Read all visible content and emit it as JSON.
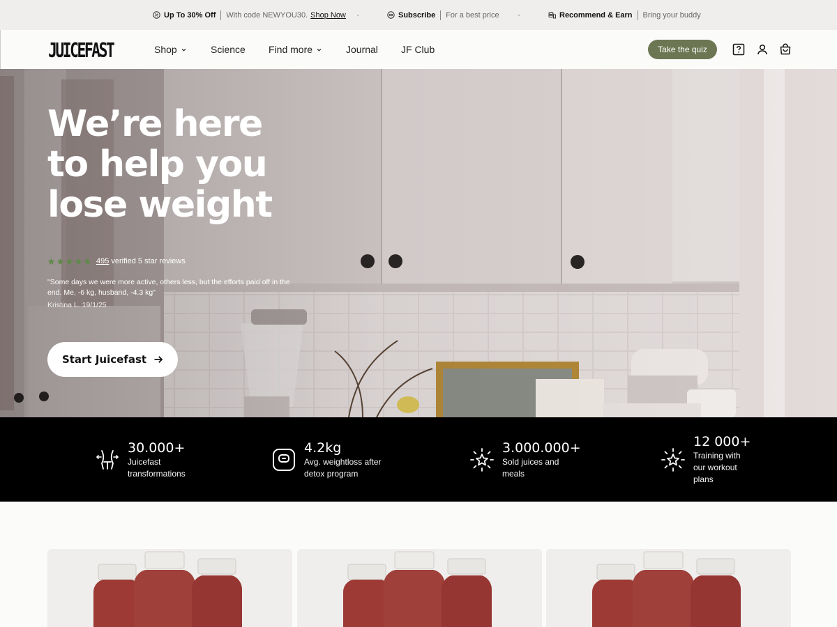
{
  "announcement": {
    "promo_strong": "Up To 30% Off",
    "promo_muted": "With code NEWYOU30.",
    "promo_link": "Shop Now",
    "subscribe_strong": "Subscribe",
    "subscribe_muted": "For a best price",
    "recommend_strong": "Recommend & Earn",
    "recommend_muted": "Bring your buddy"
  },
  "nav": {
    "logo": "JUICEFAST",
    "items": [
      {
        "label": "Shop",
        "has_dropdown": true
      },
      {
        "label": "Science",
        "has_dropdown": false
      },
      {
        "label": "Find more",
        "has_dropdown": true
      },
      {
        "label": "Journal",
        "has_dropdown": false
      },
      {
        "label": "JF Club",
        "has_dropdown": false
      }
    ],
    "quiz_button": "Take the quiz",
    "icons": [
      "help-icon",
      "account-icon",
      "cart-icon"
    ],
    "accent_color": "#6d7653"
  },
  "hero": {
    "title_lines": [
      "We’re here",
      "to help you",
      "lose weight"
    ],
    "rating_stars": 5,
    "review_count": "495",
    "review_text": "verified 5 star reviews",
    "quote": "\"Some days we were more active, others less, but the efforts paid off in the end. Me, -6 kg, husband, -4.3 kg\"",
    "quote_author": "Kristina L. 19/1/25",
    "cta_label": "Start Juicefast",
    "star_color": "#5f8a4a"
  },
  "stats": [
    {
      "icon": "waist-icon",
      "value": "30.000+",
      "label": "Juicefast transformations"
    },
    {
      "icon": "scale-icon",
      "value": "4.2kg",
      "label": "Avg. weightloss after detox program"
    },
    {
      "icon": "sparkle-star-icon",
      "value": "3.000.000+",
      "label": "Sold juices and meals"
    },
    {
      "icon": "sparkle-star-icon",
      "value": "12 000+",
      "label": "Training with our workout plans"
    }
  ],
  "products": {
    "cards": [
      {
        "name": "product-card-1"
      },
      {
        "name": "product-card-2"
      },
      {
        "name": "product-card-3"
      }
    ]
  }
}
